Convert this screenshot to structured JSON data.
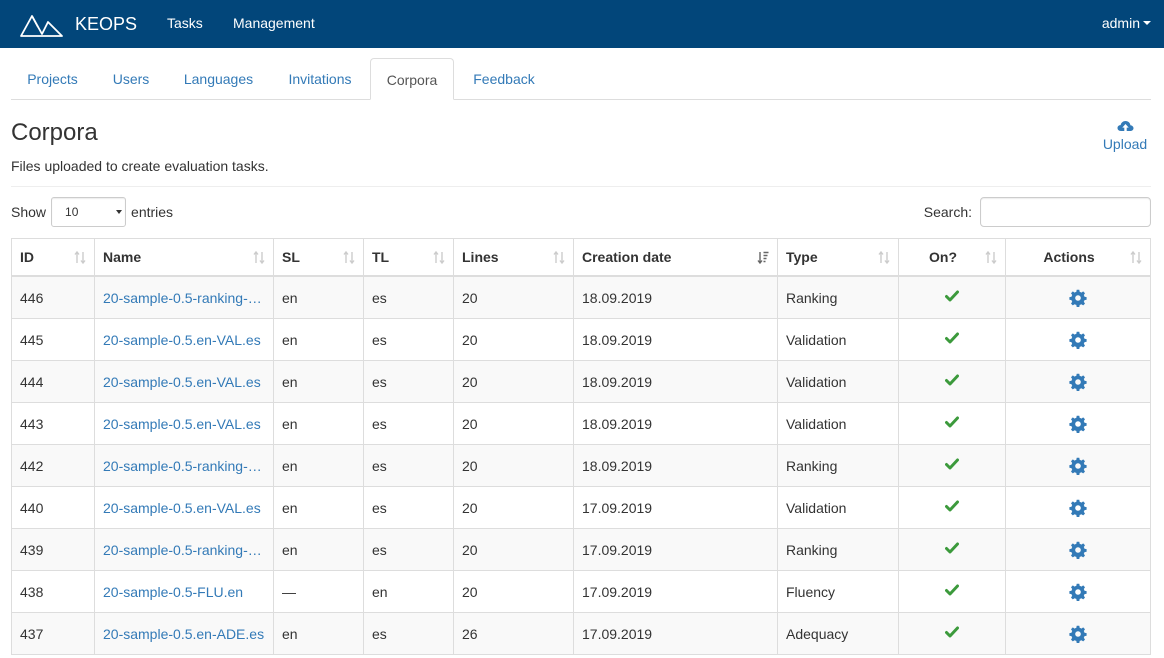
{
  "navbar": {
    "brand": "KEOPS",
    "links": [
      "Tasks",
      "Management"
    ],
    "user": "admin",
    "bg_color": "#02467a"
  },
  "tabs": [
    {
      "label": "Projects",
      "active": false
    },
    {
      "label": "Users",
      "active": false
    },
    {
      "label": "Languages",
      "active": false
    },
    {
      "label": "Invitations",
      "active": false
    },
    {
      "label": "Corpora",
      "active": true
    },
    {
      "label": "Feedback",
      "active": false
    }
  ],
  "page": {
    "title": "Corpora",
    "subtitle": "Files uploaded to create evaluation tasks.",
    "upload_label": "Upload",
    "upload_icon": "cloud-upload-icon"
  },
  "controls": {
    "show_label": "Show",
    "page_size": "10",
    "entries_label": "entries",
    "search_label": "Search:",
    "search_value": ""
  },
  "table": {
    "columns": [
      "ID",
      "Name",
      "SL",
      "TL",
      "Lines",
      "Creation date",
      "Type",
      "On?",
      "Actions"
    ],
    "sorted_column": "Creation date",
    "sort_direction": "descending",
    "rows": [
      {
        "id": "446",
        "name": "20-sample-0.5-ranking-…",
        "sl": "en",
        "tl": "es",
        "lines": "20",
        "date": "18.09.2019",
        "type": "Ranking",
        "on": true
      },
      {
        "id": "445",
        "name": "20-sample-0.5.en-VAL.es",
        "sl": "en",
        "tl": "es",
        "lines": "20",
        "date": "18.09.2019",
        "type": "Validation",
        "on": true
      },
      {
        "id": "444",
        "name": "20-sample-0.5.en-VAL.es",
        "sl": "en",
        "tl": "es",
        "lines": "20",
        "date": "18.09.2019",
        "type": "Validation",
        "on": true
      },
      {
        "id": "443",
        "name": "20-sample-0.5.en-VAL.es",
        "sl": "en",
        "tl": "es",
        "lines": "20",
        "date": "18.09.2019",
        "type": "Validation",
        "on": true
      },
      {
        "id": "442",
        "name": "20-sample-0.5-ranking-…",
        "sl": "en",
        "tl": "es",
        "lines": "20",
        "date": "18.09.2019",
        "type": "Ranking",
        "on": true
      },
      {
        "id": "440",
        "name": "20-sample-0.5.en-VAL.es",
        "sl": "en",
        "tl": "es",
        "lines": "20",
        "date": "17.09.2019",
        "type": "Validation",
        "on": true
      },
      {
        "id": "439",
        "name": "20-sample-0.5-ranking-…",
        "sl": "en",
        "tl": "es",
        "lines": "20",
        "date": "17.09.2019",
        "type": "Ranking",
        "on": true
      },
      {
        "id": "438",
        "name": "20-sample-0.5-FLU.en",
        "sl": "—",
        "tl": "en",
        "lines": "20",
        "date": "17.09.2019",
        "type": "Fluency",
        "on": true
      },
      {
        "id": "437",
        "name": "20-sample-0.5.en-ADE.es",
        "sl": "en",
        "tl": "es",
        "lines": "26",
        "date": "17.09.2019",
        "type": "Adequacy",
        "on": true
      }
    ],
    "check_color": "#3c9a3c",
    "gear_color": "#337ab7",
    "link_color": "#337ab7"
  }
}
